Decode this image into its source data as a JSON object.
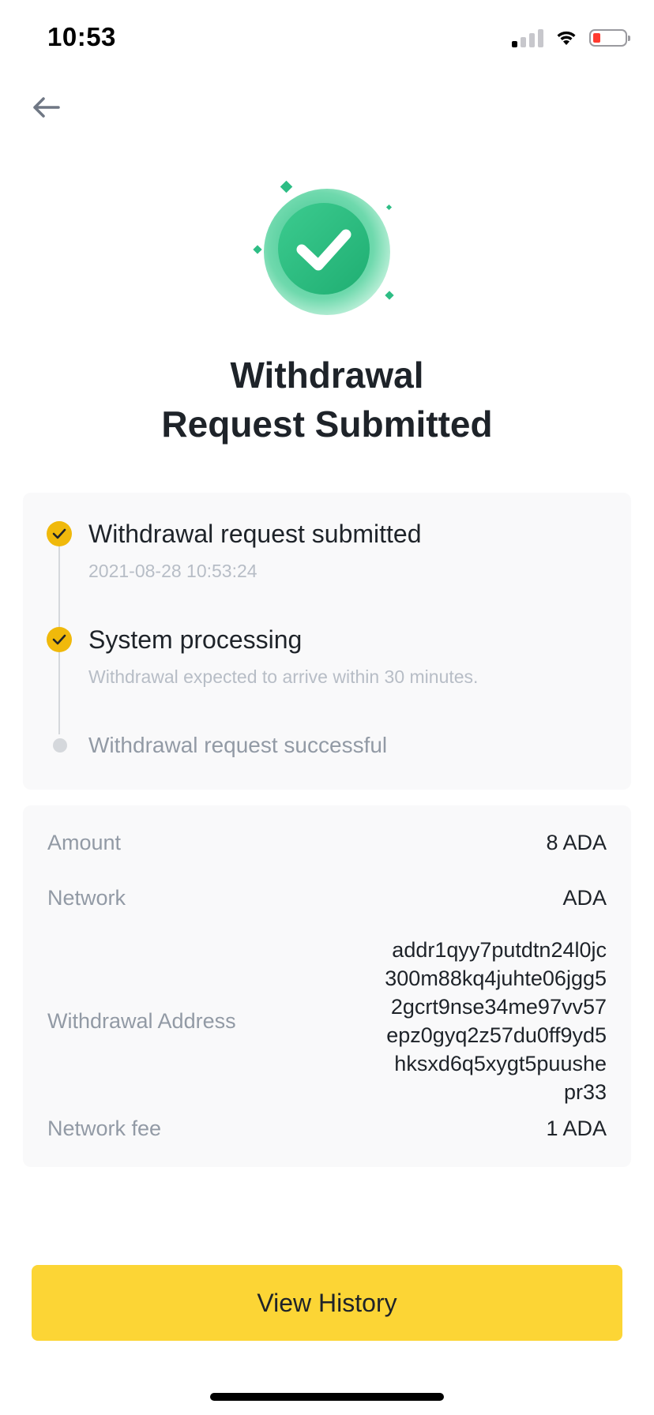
{
  "status_bar": {
    "time": "10:53"
  },
  "header": {
    "back_icon": "arrow-left-icon"
  },
  "hero": {
    "icon": "success-check-icon",
    "title_line1": "Withdrawal",
    "title_line2": "Request Submitted"
  },
  "timeline": {
    "steps": [
      {
        "title": "Withdrawal request submitted",
        "subtitle": "2021-08-28 10:53:24",
        "status": "done"
      },
      {
        "title": "System processing",
        "subtitle": "Withdrawal expected to arrive within 30 minutes.",
        "status": "done"
      },
      {
        "title": "Withdrawal request successful",
        "status": "pending"
      }
    ]
  },
  "details": {
    "amount_label": "Amount",
    "amount_value": "8 ADA",
    "network_label": "Network",
    "network_value": "ADA",
    "address_label": "Withdrawal Address",
    "address_lines": [
      "addr1qyy7putdtn24l0jc",
      "300m88kq4juhte06jgg5",
      "2gcrt9nse34me97vv57",
      "epz0gyq2z57du0ff9yd5",
      "hksxd6q5xygt5puushe",
      "pr33"
    ],
    "fee_label": "Network fee",
    "fee_value": "1 ADA"
  },
  "footer": {
    "button_label": "View History"
  },
  "colors": {
    "accent": "#FCD535",
    "success": "#2EBD85",
    "step_done": "#F0B90B"
  }
}
